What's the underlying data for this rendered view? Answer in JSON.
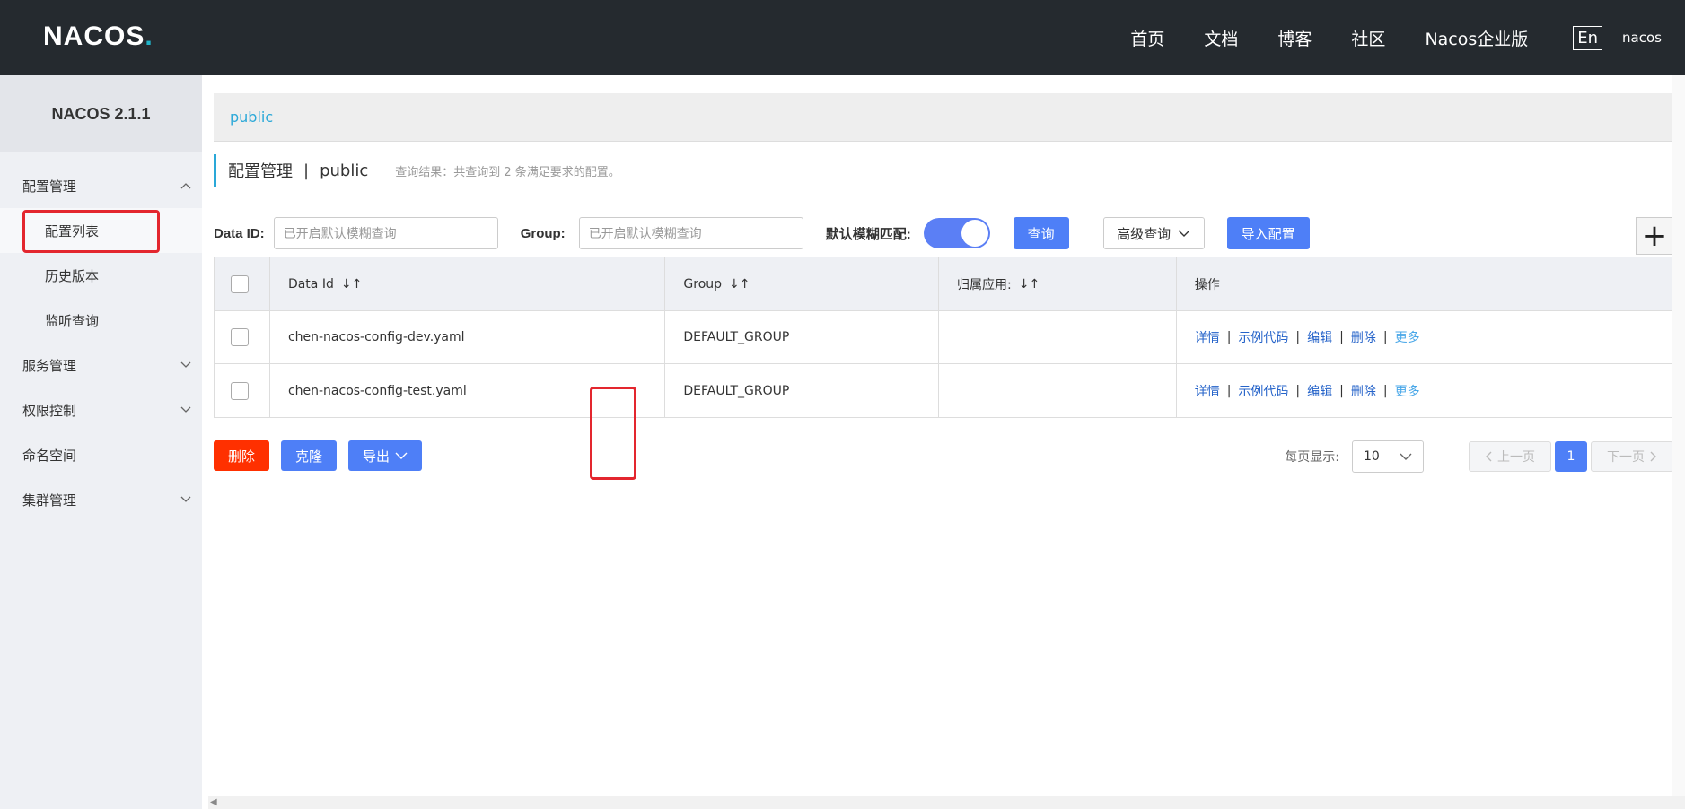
{
  "header": {
    "logo_text": "NACOS",
    "logo_dot": ".",
    "nav": [
      "首页",
      "文档",
      "博客",
      "社区",
      "Nacos企业版"
    ],
    "lang": "En",
    "user": "nacos"
  },
  "sidebar": {
    "version": "NACOS 2.1.1",
    "items": [
      {
        "label": "配置管理",
        "type": "group",
        "chevron": "up"
      },
      {
        "label": "配置列表",
        "type": "sub",
        "active": true
      },
      {
        "label": "历史版本",
        "type": "sub"
      },
      {
        "label": "监听查询",
        "type": "sub"
      },
      {
        "label": "服务管理",
        "type": "group",
        "chevron": "down"
      },
      {
        "label": "权限控制",
        "type": "group",
        "chevron": "down"
      },
      {
        "label": "命名空间",
        "type": "group"
      },
      {
        "label": "集群管理",
        "type": "group",
        "chevron": "down"
      }
    ]
  },
  "namespace": {
    "current": "public"
  },
  "page": {
    "title": "配置管理",
    "separator": "|",
    "namespace": "public",
    "result_text": "查询结果：共查询到 2 条满足要求的配置。"
  },
  "filters": {
    "data_id_label": "Data ID:",
    "data_id_placeholder": "已开启默认模糊查询",
    "group_label": "Group:",
    "group_placeholder": "已开启默认模糊查询",
    "fuzzy_label": "默认模糊匹配:",
    "fuzzy_on": true,
    "query_button": "查询",
    "advanced_button": "高级查询",
    "import_button": "导入配置",
    "add_button": "+"
  },
  "table": {
    "columns": [
      "Data Id",
      "Group",
      "归属应用:",
      "操作"
    ],
    "rows": [
      {
        "data_id": "chen-nacos-config-dev.yaml",
        "group": "DEFAULT_GROUP",
        "app": ""
      },
      {
        "data_id": "chen-nacos-config-test.yaml",
        "group": "DEFAULT_GROUP",
        "app": ""
      }
    ],
    "ops": [
      "详情",
      "示例代码",
      "编辑",
      "删除",
      "更多"
    ]
  },
  "actions": {
    "delete": "删除",
    "clone": "克隆",
    "export": "导出"
  },
  "pager": {
    "per_page_label": "每页显示:",
    "per_page": "10",
    "prev": "上一页",
    "page": "1",
    "next": "下一页"
  },
  "colors": {
    "header_bg": "#252a2f",
    "accent": "#4e7ff7",
    "danger": "#ff3000",
    "highlight": "#e3262e"
  }
}
